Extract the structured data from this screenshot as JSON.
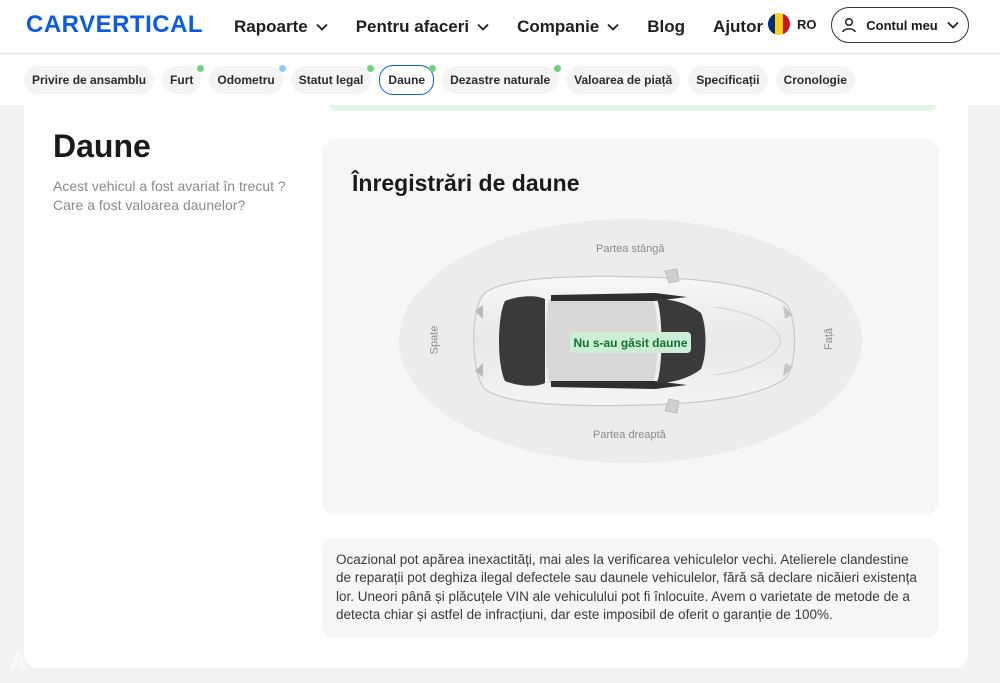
{
  "header": {
    "logo": "CARVERTICAL",
    "nav": [
      {
        "label": "Rapoarte",
        "has_dropdown": true
      },
      {
        "label": "Pentru afaceri",
        "has_dropdown": true
      },
      {
        "label": "Companie",
        "has_dropdown": true
      },
      {
        "label": "Blog",
        "has_dropdown": false
      },
      {
        "label": "Ajutor",
        "has_dropdown": false
      }
    ],
    "language": "RO",
    "account_label": "Contul meu"
  },
  "tabs": [
    {
      "label": "Privire de ansamblu",
      "dot": null
    },
    {
      "label": "Furt",
      "dot": "green"
    },
    {
      "label": "Odometru",
      "dot": "blue"
    },
    {
      "label": "Statut legal",
      "dot": "green"
    },
    {
      "label": "Daune",
      "dot": "green",
      "active": true
    },
    {
      "label": "Dezastre naturale",
      "dot": "green"
    },
    {
      "label": "Valoarea de piață",
      "dot": null
    },
    {
      "label": "Specificații",
      "dot": null
    },
    {
      "label": "Cronologie",
      "dot": null
    }
  ],
  "section": {
    "title": "Daune",
    "subtitle": "Acest vehicul a fost avariat în trecut ? Care a fost valoarea daunelor?"
  },
  "records": {
    "title": "Înregistrări de daune",
    "labels": {
      "left": "Partea stângă",
      "right": "Partea dreaptă",
      "rear": "Spate",
      "front": "Față"
    },
    "status": "Nu s-au găsit daune"
  },
  "disclaimer": "Ocazional pot apărea inexactități, mai ales la verificarea vehiculelor vechi. Atelierele clandestine de reparații pot deghiza ilegal defectele sau daunele vehiculelor, fără să declare nicăieri existența lor. Uneori până și plăcuțele VIN ale vehiculului pot fi înlocuite. Avem o varietate de metode de a detecta chiar și astfel de infracțiuni, dar este imposibil de oferit o garanție de 100%.",
  "watermark": "AUTOVIT.RO",
  "colors": {
    "brand": "#0a5ce6",
    "green_dot": "#6dd37f",
    "blue_dot": "#8ecbf2",
    "status_bg": "#cdeed6"
  }
}
